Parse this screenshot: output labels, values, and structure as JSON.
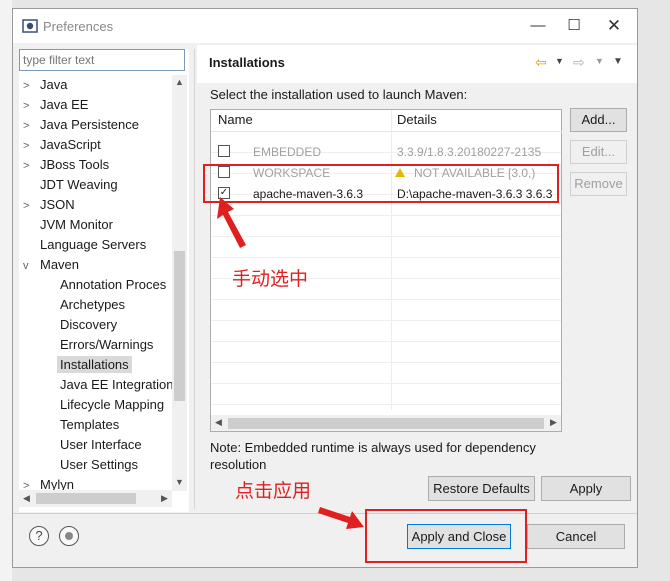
{
  "window": {
    "title": "Preferences"
  },
  "filter": {
    "placeholder": "type filter text"
  },
  "tree": [
    {
      "label": "Java",
      "chevron": ">",
      "indent": 0
    },
    {
      "label": "Java EE",
      "chevron": ">",
      "indent": 0
    },
    {
      "label": "Java Persistence",
      "chevron": ">",
      "indent": 0
    },
    {
      "label": "JavaScript",
      "chevron": ">",
      "indent": 0
    },
    {
      "label": "JBoss Tools",
      "chevron": ">",
      "indent": 0
    },
    {
      "label": "JDT Weaving",
      "chevron": "",
      "indent": 0
    },
    {
      "label": "JSON",
      "chevron": ">",
      "indent": 0
    },
    {
      "label": "JVM Monitor",
      "chevron": "",
      "indent": 0
    },
    {
      "label": "Language Servers",
      "chevron": "",
      "indent": 0
    },
    {
      "label": "Maven",
      "chevron": "v",
      "indent": 0
    },
    {
      "label": "Annotation Proces",
      "chevron": "",
      "indent": 1
    },
    {
      "label": "Archetypes",
      "chevron": "",
      "indent": 1
    },
    {
      "label": "Discovery",
      "chevron": "",
      "indent": 1
    },
    {
      "label": "Errors/Warnings",
      "chevron": "",
      "indent": 1
    },
    {
      "label": "Installations",
      "chevron": "",
      "indent": 1,
      "selected": true
    },
    {
      "label": "Java EE Integration",
      "chevron": "",
      "indent": 1
    },
    {
      "label": "Lifecycle Mapping",
      "chevron": "",
      "indent": 1
    },
    {
      "label": "Templates",
      "chevron": "",
      "indent": 1
    },
    {
      "label": "User Interface",
      "chevron": "",
      "indent": 1
    },
    {
      "label": "User Settings",
      "chevron": "",
      "indent": 1
    },
    {
      "label": "Mylyn",
      "chevron": ">",
      "indent": 0
    }
  ],
  "page": {
    "title": "Installations",
    "prompt": "Select the installation used to launch Maven:",
    "columns": {
      "name": "Name",
      "details": "Details"
    },
    "rows": [
      {
        "checked": false,
        "name": "EMBEDDED",
        "details": "3.3.9/1.8.3.20180227-2135",
        "dim": true,
        "warning": false
      },
      {
        "checked": false,
        "name": "WORKSPACE",
        "details": "NOT AVAILABLE [3.0,)",
        "dim": true,
        "warning": true
      },
      {
        "checked": true,
        "name": "apache-maven-3.6.3",
        "details": "D:\\apache-maven-3.6.3 3.6.3",
        "dim": false,
        "warning": false
      }
    ],
    "buttons": {
      "add": "Add...",
      "edit": "Edit...",
      "remove": "Remove"
    },
    "note": "Note: Embedded runtime is always used for dependency resolution",
    "restore_defaults": "Restore Defaults",
    "apply": "Apply"
  },
  "footer": {
    "help_icon": "?",
    "apply_close": "Apply and Close",
    "cancel": "Cancel"
  },
  "annotations": {
    "manual_select": "手动选中",
    "click_apply": "点击应用",
    "color": "#e02020"
  }
}
